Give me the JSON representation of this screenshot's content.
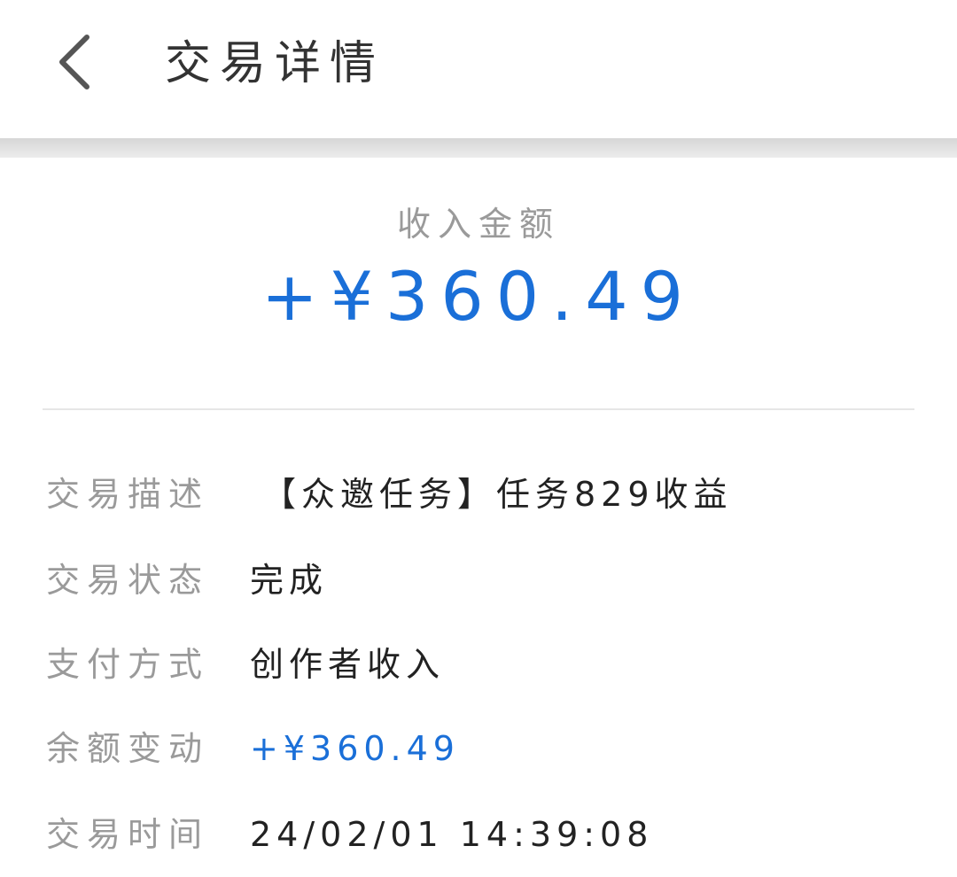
{
  "header": {
    "title": "交易详情",
    "back_icon": "chevron-left-icon"
  },
  "summary": {
    "label": "收入金额",
    "amount": "+¥360.49"
  },
  "details": [
    {
      "label": "交易描述",
      "value": "【众邀任务】任务829收益"
    },
    {
      "label": "交易状态",
      "value": "完成"
    },
    {
      "label": "支付方式",
      "value": "创作者收入"
    },
    {
      "label": "余额变动",
      "value": "+¥360.49"
    },
    {
      "label": "交易时间",
      "value": "24/02/01 14:39:08"
    }
  ],
  "colors": {
    "accent": "#1a6fd8",
    "label": "#9a9a9a",
    "text": "#222222",
    "title": "#333333"
  }
}
